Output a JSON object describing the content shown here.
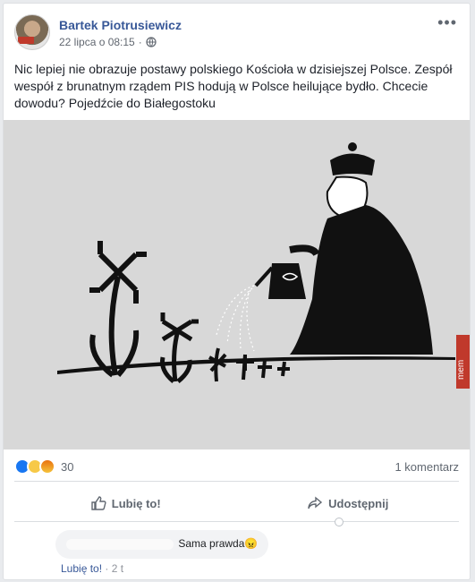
{
  "post": {
    "author": "Bartek Piotrusiewicz",
    "date": "22 lipca o 08:15",
    "separator": "·",
    "more_icon": "more-horizontal-icon",
    "privacy_icon": "globe-icon",
    "text": "Nic lepiej nie obrazuje postawy polskiego Kościoła w dzisiejszej Polsce. Zespół wespół z brunatnym rządem PIS hodują w Polsce heilujące bydło. Chcecie dowodu? Pojedźcie do Białegostoku",
    "image_watermark": "mem"
  },
  "stats": {
    "reaction_icons": [
      "like-icon",
      "sad-icon",
      "angry-icon"
    ],
    "reaction_count": "30",
    "comments_count": "1 komentarz"
  },
  "actions": {
    "like_label": "Lubię to!",
    "share_label": "Udostępnij"
  },
  "comment": {
    "text": "Sama prawda",
    "emoji": "😠",
    "like_label": "Lubię to!",
    "dot": "·",
    "time": "2 t"
  },
  "colors": {
    "link_blue": "#385898",
    "like_blue": "#1877f2",
    "text_gray": "#606770"
  }
}
